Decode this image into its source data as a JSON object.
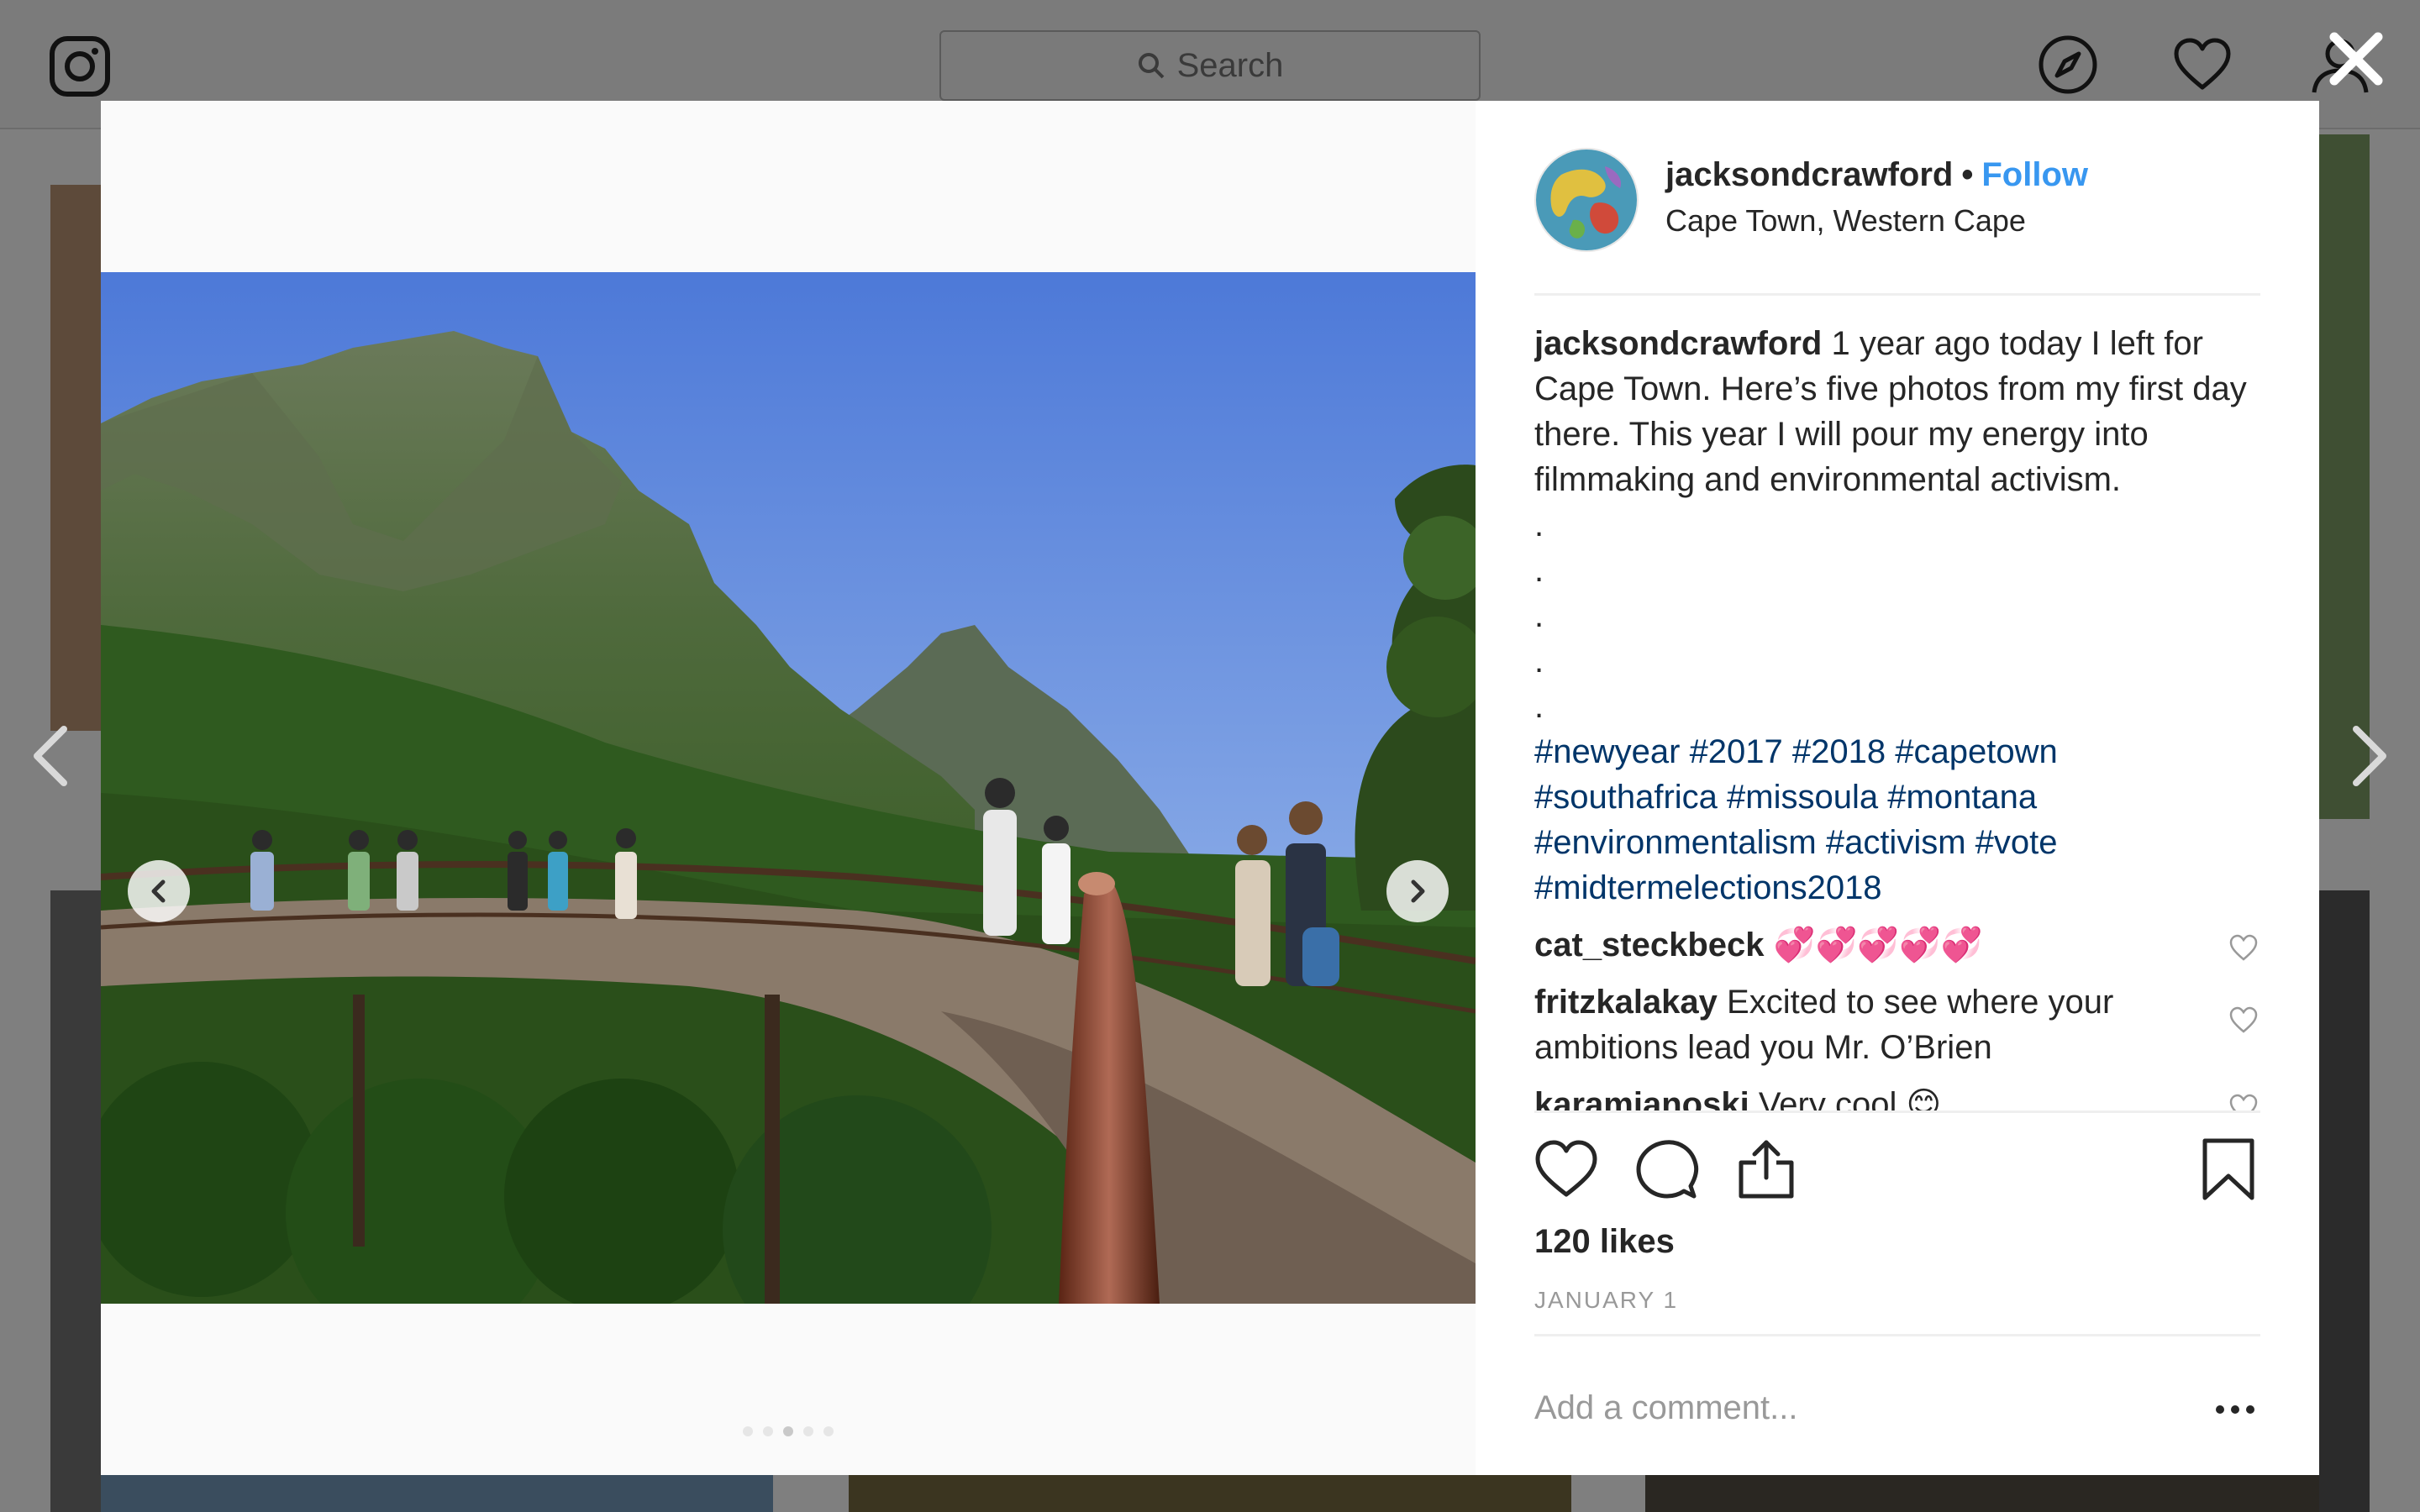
{
  "app": {
    "name": "Instagram"
  },
  "topbar": {
    "search_placeholder": "Search"
  },
  "post": {
    "username": "jacksondcrawford",
    "follow_label": "Follow",
    "separator": "•",
    "location": "Cape Town, Western Cape",
    "caption": {
      "username": "jacksondcrawford",
      "text": "1 year ago today I left for Cape Town. Here’s five photos from my first day there. This year I will pour my energy into filmmaking and environmental activism.",
      "dots": [
        ".",
        ".",
        ".",
        ".",
        "."
      ],
      "hashtags": [
        "#newyear",
        "#2017",
        "#2018",
        "#capetown",
        "#southafrica",
        "#missoula",
        "#montana",
        "#environmentalism",
        "#activism",
        "#vote",
        "#midtermelections2018"
      ]
    },
    "comments": [
      {
        "username": "cat_steckbeck",
        "text": "💞💞💞💞💞"
      },
      {
        "username": "fritzkalakay",
        "text": "Excited to see where your ambitions lead you Mr. O’Brien"
      },
      {
        "username": "karamianoski",
        "text": "Very cool 😊"
      }
    ],
    "likes": "120 likes",
    "date": "JANUARY 1",
    "add_comment_placeholder": "Add a comment...",
    "more_label": "•••",
    "carousel": {
      "count": 5,
      "active_index": 2
    }
  },
  "icons": {
    "logo": "instagram-logo-icon",
    "search": "search-icon",
    "explore": "compass-icon",
    "activity": "heart-icon",
    "profile": "user-icon",
    "close": "close-icon",
    "like": "heart-outline-icon",
    "comment": "speech-bubble-icon",
    "share": "share-icon",
    "save": "bookmark-icon"
  },
  "colors": {
    "link_blue": "#3897f0",
    "hashtag": "#003569",
    "muted": "#999999"
  }
}
